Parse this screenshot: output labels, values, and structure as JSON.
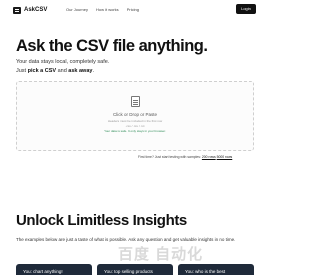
{
  "nav": {
    "logo": "AskCSV",
    "links": [
      "Our Journey",
      "How it works",
      "Pricing"
    ],
    "login": "Login"
  },
  "hero": {
    "title": "Ask the CSV file anything.",
    "subtitle1": "Your data stays local, completely safe.",
    "subtitle2_prefix": "Just ",
    "subtitle2_bold1": "pick a CSV",
    "subtitle2_mid": " and ",
    "subtitle2_bold2": "ask away",
    "subtitle2_suffix": "."
  },
  "dropzone": {
    "title": "Click or Drop or Paste",
    "note": "Headers must be included in the first row",
    "types": ".csv / .tsv / .txt",
    "safe": "Your data is safe. It only stays in your browser."
  },
  "samples": {
    "prefix": "First time? Just start testing with samples:",
    "link1": "200 rows",
    "link2": "5000 rows"
  },
  "section": {
    "title": "Unlock Limitless Insights",
    "subtitle": "The examples below are just a taste of what is possible. Ask any question and get valuable insights in no time."
  },
  "cards": [
    "You: chart anything!",
    "You: top selling products",
    "You: who is the best"
  ],
  "watermark": "百度 自动化"
}
